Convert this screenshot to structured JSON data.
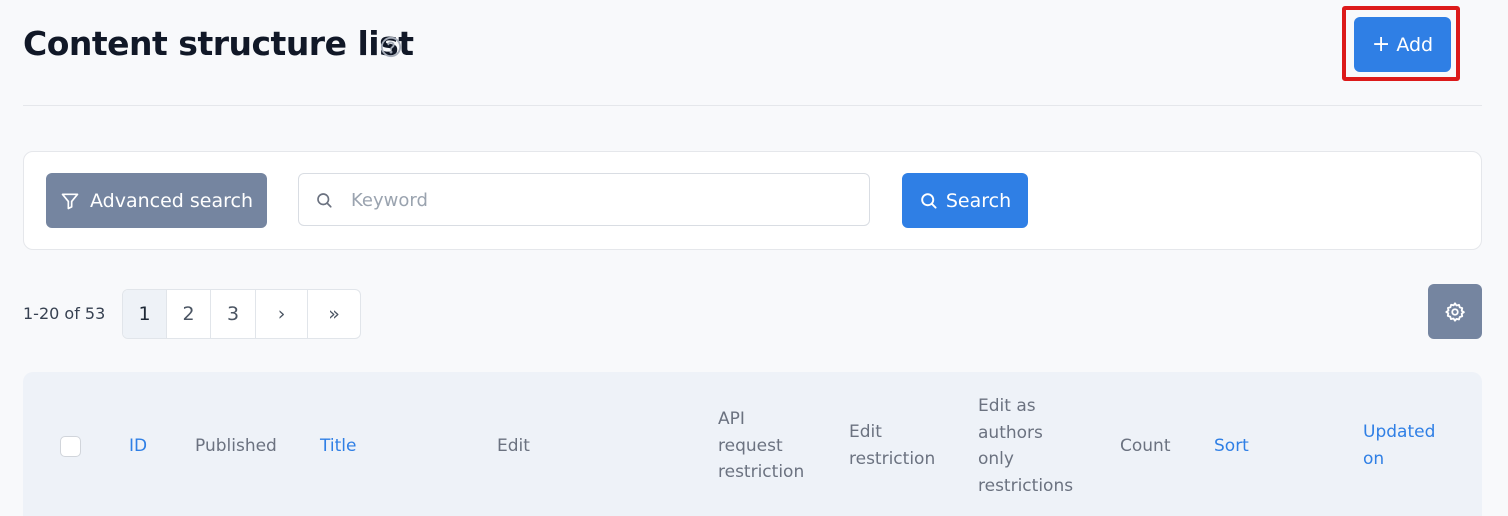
{
  "header": {
    "title": "Content structure list",
    "add_label": "Add"
  },
  "search": {
    "advanced_label": "Advanced search",
    "keyword_placeholder": "Keyword",
    "keyword_value": "",
    "search_label": "Search"
  },
  "pagination": {
    "range": "1-20 of 53",
    "pages": [
      "1",
      "2",
      "3"
    ],
    "current_page": "1",
    "next_symbol": "›",
    "last_symbol": "»"
  },
  "table": {
    "columns": {
      "id": "ID",
      "published": "Published",
      "title": "Title",
      "edit": "Edit",
      "api_request_restriction": [
        "API",
        "request",
        "restriction"
      ],
      "edit_restriction": [
        "Edit",
        "restriction"
      ],
      "edit_as_authors": [
        "Edit as",
        "authors",
        "only",
        "restrictions"
      ],
      "count": "Count",
      "sort": "Sort",
      "updated_on": [
        "Updated",
        "on"
      ]
    }
  },
  "icons": {
    "help": "help-circle-icon",
    "add": "plus-icon",
    "filter": "filter-icon",
    "search": "search-icon",
    "settings": "gear-icon"
  },
  "colors": {
    "primary": "#2f7fe5",
    "secondary": "#7585a0",
    "highlight": "#dc1a1a",
    "table_header_bg": "#eef2f8"
  }
}
